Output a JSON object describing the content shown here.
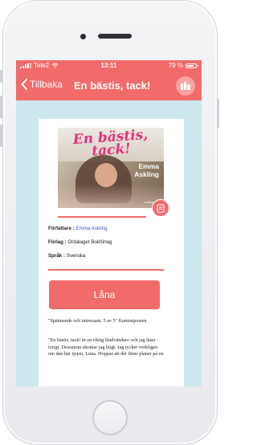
{
  "status_bar": {
    "carrier": "Tele2",
    "time": "13:11",
    "battery": "79 %",
    "battery_level": 0.79
  },
  "nav": {
    "back_label": "Tillbaka",
    "title": "En bästis, tack!"
  },
  "book": {
    "cover": {
      "title": "En bästis, tack!",
      "author_first": "Emma",
      "author_last": "Askling",
      "publisher": "ordalaget"
    },
    "author_label": "Författare :",
    "author": "Emma Askling",
    "publisher_label": "Förlag :",
    "publisher": "Ordalaget Bokförlag",
    "language_label": "Språk :",
    "language": "Svenska"
  },
  "loan_button": "Låna",
  "quote": "\"Spännande och intressant. 5 av 5\" Kamratposten",
  "description": "\"En bästis, tack! är en riktig bladvändare och jag läser ivrigt. Dessutom skrattar jag högt. Jag tycker verkligen om den här tjejen, Luna. Hoppas att det finns planer på en",
  "colors": {
    "accent": "#f16b6b",
    "screen_background": "#cde7ee",
    "link": "#3b56c7"
  }
}
